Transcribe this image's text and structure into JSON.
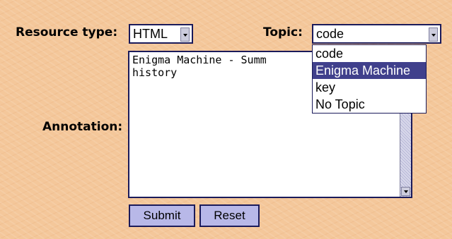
{
  "labels": {
    "resource_type": "Resource type:",
    "topic": "Topic:",
    "annotation": "Annotation:"
  },
  "resource_select": {
    "value": "HTML"
  },
  "topic_select": {
    "value": "code",
    "options": [
      "code",
      "Enigma Machine",
      "key",
      "No Topic"
    ],
    "highlighted": "Enigma Machine"
  },
  "annotation_text": "Enigma Machine - Summ\nhistory",
  "buttons": {
    "submit": "Submit",
    "reset": "Reset"
  },
  "colors": {
    "highlight": "#40408c",
    "button_bg": "#b8b8e8",
    "background": "#f4c79a"
  }
}
